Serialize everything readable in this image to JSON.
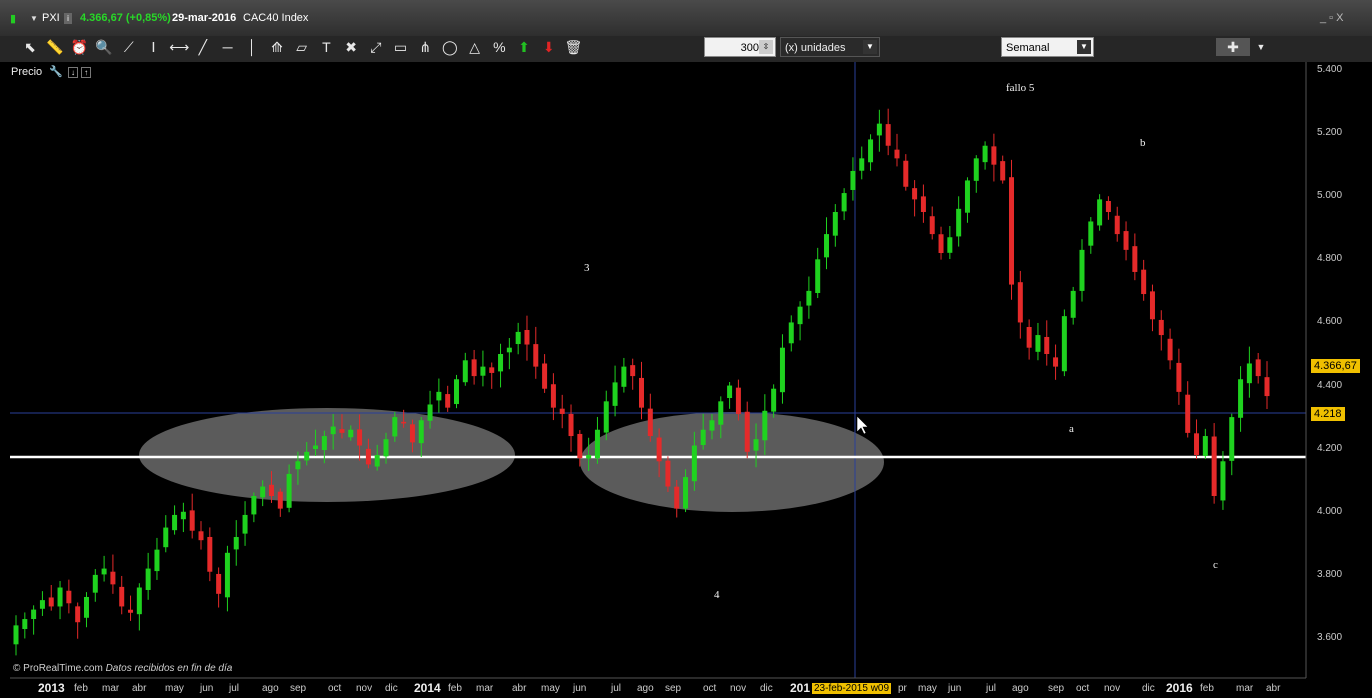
{
  "title_bar": {
    "symbol": "PXI",
    "price_change": "4.366,67 (+0,85%)",
    "date": "29-mar-2016",
    "index_name": "CAC40 Index",
    "window_controls": "_ ▫ X"
  },
  "toolbar": {
    "tool_icons": [
      "cursor-icon",
      "ruler-icon",
      "alarm-icon",
      "zoom-icon",
      "trendline-icon",
      "vertical-line-icon",
      "horizontal-segment-icon",
      "diagonal-line-icon",
      "horizontal-line-icon",
      "vertical-marker-icon",
      "fan-icon",
      "channel-icon",
      "text-icon",
      "tools-icon",
      "expand-icon",
      "rectangle-icon",
      "pitchfork-icon",
      "ellipse-icon",
      "triangle-icon",
      "percent-icon",
      "buy-arrow-icon",
      "sell-arrow-icon",
      "trash-icon"
    ],
    "units_value": "300",
    "units_label": "(x) unidades",
    "period": "Semanal"
  },
  "panel": {
    "label": "Precio",
    "credit": "© ProRealTime.com",
    "credit_note": "Datos recibidos en fin de día"
  },
  "chart_data": {
    "type": "candlestick",
    "grid": false,
    "y_axis": {
      "ticks": [
        "3.600",
        "3.800",
        "4.000",
        "4.200",
        "4.400",
        "4.600",
        "4.800",
        "5.000",
        "5.200",
        "5.400"
      ],
      "range": [
        3540,
        5420
      ]
    },
    "x_axis": {
      "labels": [
        "2013",
        "feb",
        "mar",
        "abr",
        "may",
        "jun",
        "jul",
        "ago",
        "sep",
        "oct",
        "nov",
        "dic",
        "2014",
        "feb",
        "mar",
        "abr",
        "may",
        "jun",
        "jul",
        "ago",
        "sep",
        "oct",
        "nov",
        "dic",
        "201",
        "23-feb-2015 w09",
        "pr",
        "may",
        "jun",
        "jul",
        "ago",
        "sep",
        "oct",
        "nov",
        "dic",
        "2016",
        "feb",
        "mar",
        "abr"
      ]
    },
    "current_price": "4.366,67",
    "current_price_value": 4366.67,
    "crosshair_price": "4.218",
    "crosshair_price_value": 4218,
    "crosshair_date": "23-feb-2015 w09",
    "support_level": 4090,
    "annotations": [
      "3",
      "4",
      "fallo 5",
      "a",
      "b",
      "c"
    ],
    "weekly_closes": [
      3640,
      3660,
      3690,
      3720,
      3700,
      3760,
      3710,
      3650,
      3730,
      3800,
      3820,
      3770,
      3700,
      3680,
      3760,
      3820,
      3880,
      3950,
      3990,
      4000,
      3940,
      3910,
      3810,
      3740,
      3870,
      3920,
      3990,
      4050,
      4080,
      4050,
      4010,
      4120,
      4160,
      4190,
      4210,
      4240,
      4270,
      4250,
      4260,
      4210,
      4150,
      4180,
      4230,
      4300,
      4280,
      4220,
      4290,
      4340,
      4380,
      4330,
      4420,
      4480,
      4430,
      4460,
      4440,
      4500,
      4520,
      4570,
      4530,
      4460,
      4390,
      4330,
      4310,
      4240,
      4170,
      4180,
      4260,
      4350,
      4410,
      4460,
      4430,
      4330,
      4240,
      4160,
      4080,
      4010,
      4110,
      4210,
      4260,
      4290,
      4350,
      4400,
      4310,
      4190,
      4230,
      4320,
      4390,
      4520,
      4600,
      4650,
      4700,
      4800,
      4880,
      4950,
      5010,
      5080,
      5120,
      5180,
      5230,
      5160,
      5120,
      5030,
      4990,
      4950,
      4880,
      4820,
      4870,
      4960,
      5050,
      5120,
      5160,
      5100,
      5050,
      4720,
      4600,
      4520,
      4560,
      4500,
      4460,
      4620,
      4700,
      4830,
      4920,
      4990,
      4950,
      4880,
      4830,
      4760,
      4690,
      4610,
      4560,
      4480,
      4380,
      4250,
      4180,
      4240,
      4050,
      4160,
      4300,
      4420,
      4470,
      4430,
      4366.67
    ]
  }
}
